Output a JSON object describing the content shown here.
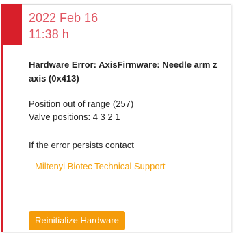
{
  "notification": {
    "date": "2022 Feb 16",
    "time": "11:38 h",
    "error_title": "Hardware Error: AxisFirmware: Needle arm z axis (0x413)",
    "detail_line_1": "Position out of range (257)",
    "detail_line_2": "Valve positions: 4 3 2 1",
    "persist_text": "If the error persists contact",
    "support_link": "Miltenyi Biotec Technical Support",
    "reinitialize_button": "Reinitialize Hardware"
  },
  "colors": {
    "accent_red": "#d81f2a",
    "timestamp_red": "#e05460",
    "link_orange": "#f5a10b",
    "button_orange": "#f59c0a"
  }
}
